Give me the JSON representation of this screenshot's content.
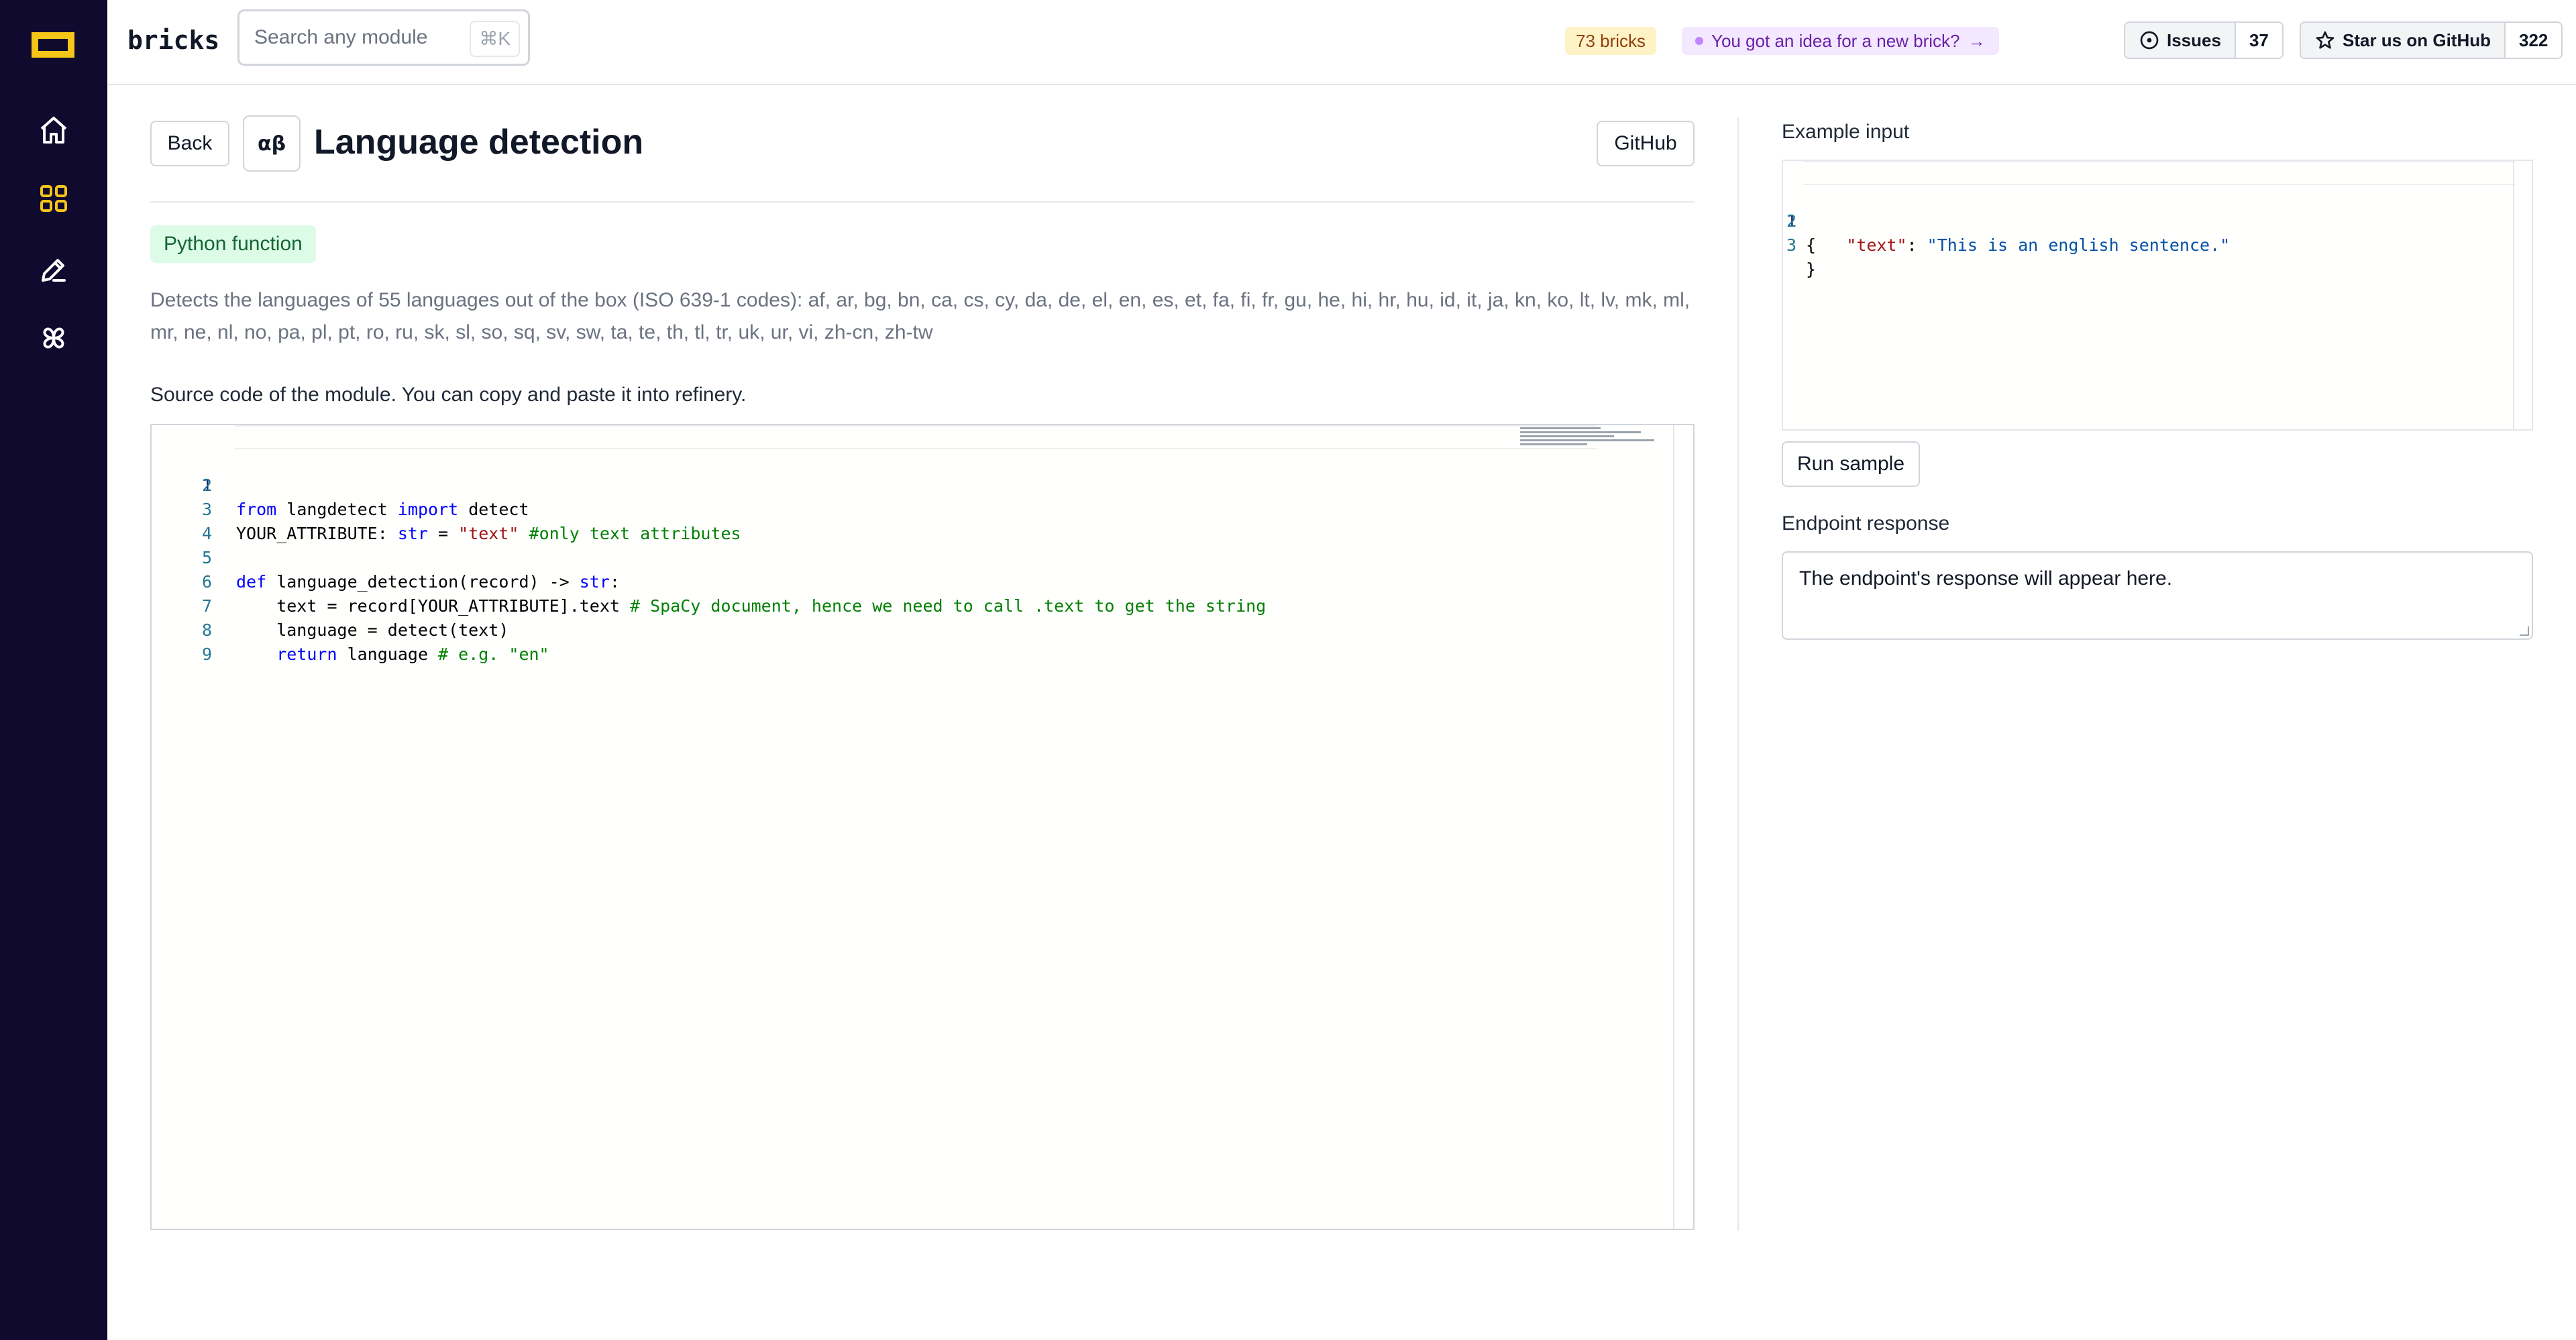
{
  "app": {
    "brand": "bricks"
  },
  "search": {
    "placeholder": "Search any module",
    "shortcut": "⌘K"
  },
  "header": {
    "bricks_count": "73 bricks",
    "idea_text": "You got an idea for a new brick?",
    "idea_arrow": "→",
    "issues_label": "Issues",
    "issues_count": "37",
    "star_label": "Star us on GitHub",
    "star_count": "322"
  },
  "sidebar": {
    "items": [
      {
        "icon": "home-icon"
      },
      {
        "icon": "grid-icon",
        "active": true
      },
      {
        "icon": "pen-icon"
      },
      {
        "icon": "pinwheel-icon"
      }
    ],
    "accent": "#f5c518",
    "background": "#0f0a2e"
  },
  "module": {
    "back_label": "Back",
    "icon_text": "αβ",
    "title": "Language detection",
    "github_label": "GitHub",
    "type_badge": "Python function",
    "description": "Detects the languages of 55 languages out of the box (ISO 639-1 codes): af, ar, bg, bn, ca, cs, cy, da, de, el, en, es, et, fa, fi, fr, gu, he, hi, hr, hu, id, it, ja, kn, ko, lt, lv, mk, ml, mr, ne, nl, no, pa, pl, pt, ro, ru, sk, sl, so, sq, sv, sw, ta, te, th, tl, tr, uk, ur, vi, zh-cn, zh-tw",
    "source_label": "Source code of the module. You can copy and paste it into refinery."
  },
  "code": {
    "line_numbers": [
      "1",
      "2",
      "3",
      "4",
      "5",
      "6",
      "7",
      "8",
      "9"
    ],
    "l1_kw1": "from",
    "l1_mod": " langdetect ",
    "l1_kw2": "import",
    "l1_rest": " detect",
    "l3_a": "YOUR_ATTRIBUTE: ",
    "l3_type": "str",
    "l3_b": " = ",
    "l3_str": "\"text\"",
    "l3_sp": " ",
    "l3_cm": "#only text attributes",
    "l5_kw": "def",
    "l5_a": " language_detection(record) -> ",
    "l5_type": "str",
    "l5_b": ":",
    "l6_a": "    text = record[YOUR_ATTRIBUTE].text ",
    "l6_cm": "# SpaCy document, hence we need to call .text to get the string",
    "l7_a": "    language = detect(text)",
    "l8_ind": "    ",
    "l8_kw": "return",
    "l8_a": " language ",
    "l8_cm": "# e.g. \"en\""
  },
  "example": {
    "label": "Example input",
    "line_numbers": [
      "1",
      "2",
      "3"
    ],
    "l1": "{",
    "l2_ind": "    ",
    "l2_key": "\"text\"",
    "l2_colon": ": ",
    "l2_val": "\"This is an english sentence.\"",
    "l3": "}",
    "run_label": "Run sample"
  },
  "response": {
    "label": "Endpoint response",
    "text": "The endpoint's response will appear here."
  }
}
